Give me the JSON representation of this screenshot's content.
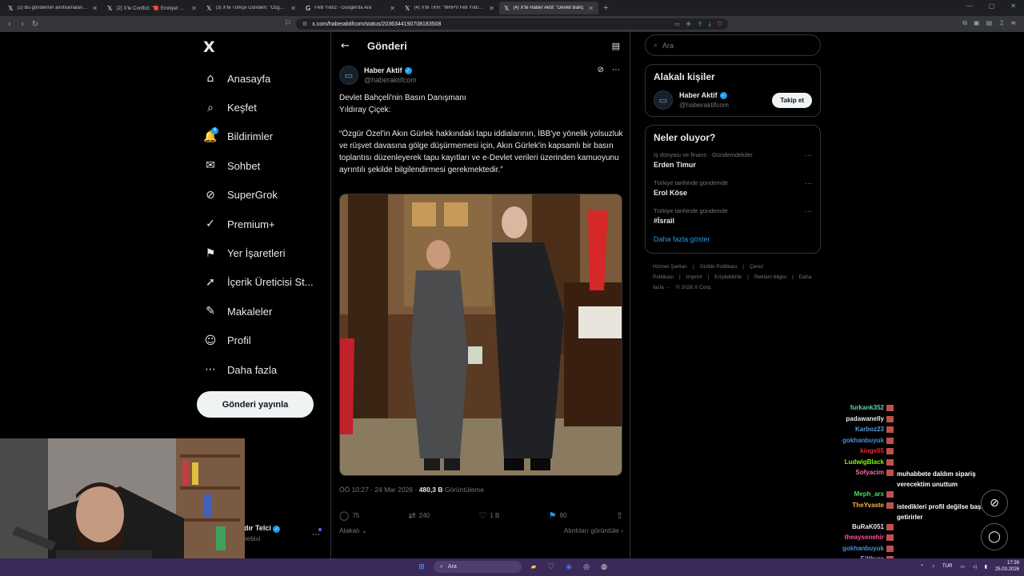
{
  "browser": {
    "tabs": [
      {
        "label": "(2) Bu gönderinin alıntılamaları / X",
        "icon": "x-logo-icon",
        "active": false
      },
      {
        "label": "(2) X'te Conflict: \"🔴 Emniyet Genel M",
        "icon": "x-logo-icon",
        "active": false
      },
      {
        "label": "(3) X'te Türkçe Gündem: \"Özgür Öze",
        "icon": "x-logo-icon",
        "active": false
      },
      {
        "label": "Fetli Yıldız - Google'da Ara",
        "icon": "google-icon",
        "active": false
      },
      {
        "label": "(4) X'te TKR: \"MHP'li Feti Yıldız, Sözcü",
        "icon": "x-logo-icon",
        "active": false
      },
      {
        "label": "(4) X'te Haber Aktif: \"Devlet Bahç",
        "icon": "x-logo-icon",
        "active": true
      }
    ],
    "url": "x.com/haberaktifcom/status/2036344190708183508"
  },
  "nav": {
    "logo": "X",
    "items": [
      {
        "label": "Anasayfa",
        "icon": "home-icon",
        "glyph": "⌂"
      },
      {
        "label": "Keşfet",
        "icon": "search-icon",
        "glyph": "⌕"
      },
      {
        "label": "Bildirimler",
        "icon": "bell-icon",
        "glyph": "🔔",
        "badge": "4"
      },
      {
        "label": "Sohbet",
        "icon": "mail-icon",
        "glyph": "✉"
      },
      {
        "label": "SuperGrok",
        "icon": "grok-icon",
        "glyph": "⊘"
      },
      {
        "label": "Premium+",
        "icon": "premium-icon",
        "glyph": "✓"
      },
      {
        "label": "Yer İşaretleri",
        "icon": "bookmark-icon",
        "glyph": "⚑"
      },
      {
        "label": "İçerik Üreticisi St...",
        "icon": "rocket-icon",
        "glyph": "➚"
      },
      {
        "label": "Makaleler",
        "icon": "article-icon",
        "glyph": "✎"
      },
      {
        "label": "Profil",
        "icon": "profile-icon",
        "glyph": "☺"
      },
      {
        "label": "Daha fazla",
        "icon": "more-circle-icon",
        "glyph": "⋯"
      }
    ],
    "post_button": "Gönderi yayınla",
    "account": {
      "name": "adır Telci",
      "handle": "rpiebixi"
    }
  },
  "main": {
    "title": "Gönderi",
    "author": {
      "name": "Haber Aktif",
      "handle": "@haberaktifcom"
    },
    "text": "Devlet Bahçeli'nin Basın Danışmanı\nYıldıray Çiçek:\n\n“Özgür Özel'in Akın Gürlek hakkındaki tapu iddialarının, İBB'ye yönelik yolsuzluk ve rüşvet davasına gölge düşürmemesi için, Akın Gürlek'in kapsamlı bir basın toplantısı düzenleyerek tapu kayıtları ve e-Devlet verileri üzerinden kamuoyunu ayrıntılı şekilde bilgilendirmesi gerekmektedir.”",
    "time": "ÖÖ 10:27 · 24 Mar 2026 · ",
    "views_count": "480,3 B",
    "views_label": " Görüntüleme",
    "stats": {
      "replies": "75",
      "reposts": "240",
      "likes": "1 B",
      "bookmarks": "90"
    },
    "sort_label": "Alakalı",
    "quotes_link": "Alıntıları görüntüle"
  },
  "right": {
    "search_placeholder": "Ara",
    "related_title": "Alakalı kişiler",
    "related_person": {
      "name": "Haber Aktif",
      "handle": "@haberaktifcom",
      "button": "Takip et"
    },
    "trends_title": "Neler oluyor?",
    "trends": [
      {
        "category": "İş dünyası ve finans · Gündemdekiler",
        "name": "Erden Timur"
      },
      {
        "category": "Türkiye tarihinde gündemde",
        "name": "Erol Köse"
      },
      {
        "category": "Türkiye tarihinde gündemde",
        "name": "#İsrail"
      }
    ],
    "show_more": "Daha fazla göster",
    "footer": [
      "Hizmet Şartları",
      "|",
      "Gizlilik Politikası",
      "|",
      "Çerez Politikası",
      "|",
      "Imprint",
      "|",
      "Erişilebilirlik",
      "|",
      "Reklam bilgisi",
      "|",
      "Daha fazla ···",
      "© 2026 X Corp."
    ]
  },
  "chat": [
    {
      "user": "furkank352",
      "color": "#5fd3a8",
      "msg": ""
    },
    {
      "user": "padawanelly",
      "color": "#e8e8e8",
      "msg": ""
    },
    {
      "user": "Karboz23",
      "color": "#5b9bd5",
      "msg": ""
    },
    {
      "user": "gokhanbuyuk",
      "color": "#4a90d9",
      "msg": ""
    },
    {
      "user": "kingx65",
      "color": "#e0303a",
      "msg": ""
    },
    {
      "user": "LudwigBlack",
      "color": "#7cfc00",
      "msg": ""
    },
    {
      "user": "Sofyacim",
      "color": "#ff69b4",
      "msg": "muhabbete daldım sipariş verecektim unuttum"
    },
    {
      "user": "Meph_arx",
      "color": "#4cd964",
      "msg": ""
    },
    {
      "user": "TheYvaste",
      "color": "#ffb347",
      "msg": "istedikleri profil değilse başkasını getirirler"
    },
    {
      "user": "BuRaK051",
      "color": "#e8e8e8",
      "msg": ""
    },
    {
      "user": "theaysenehir",
      "color": "#ff4fa0",
      "msg": ""
    },
    {
      "user": "gokhanbuyuk",
      "color": "#4a90d9",
      "msg": ""
    },
    {
      "user": "Eilthyra",
      "color": "#c77dff",
      "msg": ""
    }
  ],
  "taskbar": {
    "search": "Ara",
    "lang": "TUR",
    "time": "17:39",
    "date": "25.03.2026"
  }
}
